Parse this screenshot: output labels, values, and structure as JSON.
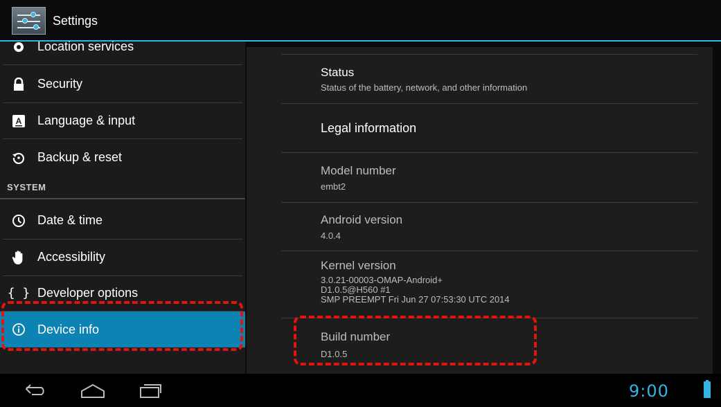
{
  "actionbar": {
    "title": "Settings"
  },
  "sidebar": {
    "items_top": [
      {
        "label": "Location services",
        "icon": "location-icon"
      },
      {
        "label": "Security",
        "icon": "lock-icon"
      },
      {
        "label": "Language & input",
        "icon": "keyboard-a-icon"
      },
      {
        "label": "Backup & reset",
        "icon": "backup-icon"
      }
    ],
    "section_system": "SYSTEM",
    "items_system": [
      {
        "label": "Date & time",
        "icon": "clock-icon"
      },
      {
        "label": "Accessibility",
        "icon": "hand-icon"
      },
      {
        "label": "Developer options",
        "icon": "braces-icon"
      },
      {
        "label": "Device info",
        "icon": "info-icon",
        "selected": true
      }
    ]
  },
  "detail": {
    "status": {
      "title": "Status",
      "summary": "Status of the battery, network, and other information"
    },
    "legal": {
      "title": "Legal information"
    },
    "model": {
      "title": "Model number",
      "value": "embt2"
    },
    "android": {
      "title": "Android version",
      "value": "4.0.4"
    },
    "kernel": {
      "title": "Kernel version",
      "line1": "3.0.21-00003-OMAP-Android+",
      "line2": "D1.0.5@H560 #1",
      "line3": "SMP PREEMPT Fri Jun 27 07:53:30 UTC 2014"
    },
    "build": {
      "title": "Build number",
      "value": "D1.0.5"
    }
  },
  "statusbar": {
    "time": "9:00"
  },
  "colors": {
    "accent": "#33b5e5",
    "selected": "#0c83b3",
    "annotation": "#e3140e"
  }
}
